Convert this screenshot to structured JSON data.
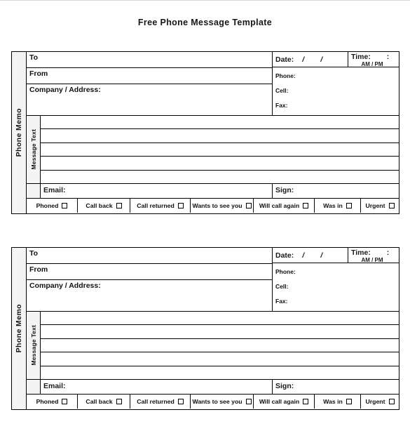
{
  "document": {
    "title": "Free Phone Message Template"
  },
  "form": {
    "rail_label": "Phone Memo",
    "message_rail_label": "Message Text",
    "fields": {
      "to": "To",
      "from": "From",
      "company_address": "Company / Address:"
    },
    "date": {
      "label": "Date:",
      "separator_1": "/",
      "separator_2": "/"
    },
    "time": {
      "label": "Time:",
      "colon": ":",
      "ampm": "AM / PM"
    },
    "contacts": [
      "Phone:",
      "Cell:",
      "Fax:"
    ],
    "message_lines": [
      "",
      "",
      "",
      "",
      ""
    ],
    "email_label": "Email:",
    "sign_label": "Sign:",
    "checkboxes": [
      {
        "label": "Phoned",
        "checked": false
      },
      {
        "label": "Call back",
        "checked": false
      },
      {
        "label": "Call returned",
        "checked": false
      },
      {
        "label": "Wants to see you",
        "checked": false
      },
      {
        "label": "Will call again",
        "checked": false
      },
      {
        "label": "Was in",
        "checked": false
      },
      {
        "label": "Urgent",
        "checked": false
      }
    ]
  },
  "copies": [
    {
      "id": "memo-1"
    },
    {
      "id": "memo-2"
    }
  ],
  "colors": {
    "page_background": "#ffffff",
    "rule": "#000000",
    "text": "#111111",
    "rail_fill": "#f4f4f4"
  }
}
